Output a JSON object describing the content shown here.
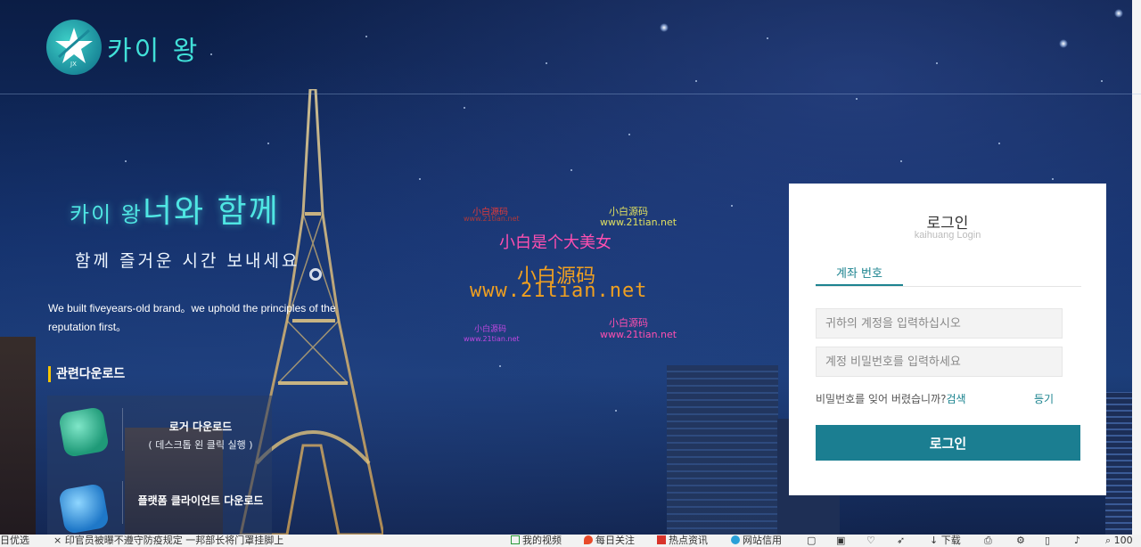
{
  "brand": {
    "name": "카이 왕",
    "logo_mark": "JX"
  },
  "hero": {
    "title_small": "카이 왕",
    "title_large": "너와 함께",
    "subtitle": "함께 즐거운 시간 보내세요",
    "description": "We built fiveyears-old brand。we uphold the principles of the reputation first。"
  },
  "downloads": {
    "heading": "관련다운로드",
    "items": [
      {
        "label": "로거 다운로드",
        "note": "( 데스크톱 왼 클릭 실행 )"
      },
      {
        "label": "플랫폼 클라이언트 다운로드",
        "note": ""
      }
    ]
  },
  "watermarks": {
    "lines": [
      "小白源码",
      "www.21tian.net",
      "小白是个大美女",
      "www.21tian.net",
      "小白源码",
      "www.21tian.net"
    ],
    "small_left_top": "小白源码",
    "small_left_url": "www.21tian.net",
    "small_left_bottom": "小白源码",
    "small_left_bottom_url": "www.21tian.net",
    "big": "小白源码"
  },
  "login": {
    "title": "로그인",
    "subtitle": "kaihuang Login",
    "tab": "계좌 번호",
    "account_placeholder": "귀하의 계정을 입력하십시오",
    "password_placeholder": "계정 비밀번호를 입력하세요",
    "forgot_text": "비밀번호를 잊어 버렸습니까?",
    "forgot_link": "검색",
    "register": "등기",
    "button": "로그인"
  },
  "statusbar": {
    "left1": "日优选",
    "left2": "× 印官员被曝不遵守防疫规定 一邦部长将门罩挂脚上",
    "items": [
      "我的视频",
      "每日关注",
      "热点资讯",
      "网站信用"
    ],
    "download": "下载",
    "zoom": "100"
  },
  "colors": {
    "accent": "#1b7e91",
    "hero_text": "#4fe6e3"
  }
}
